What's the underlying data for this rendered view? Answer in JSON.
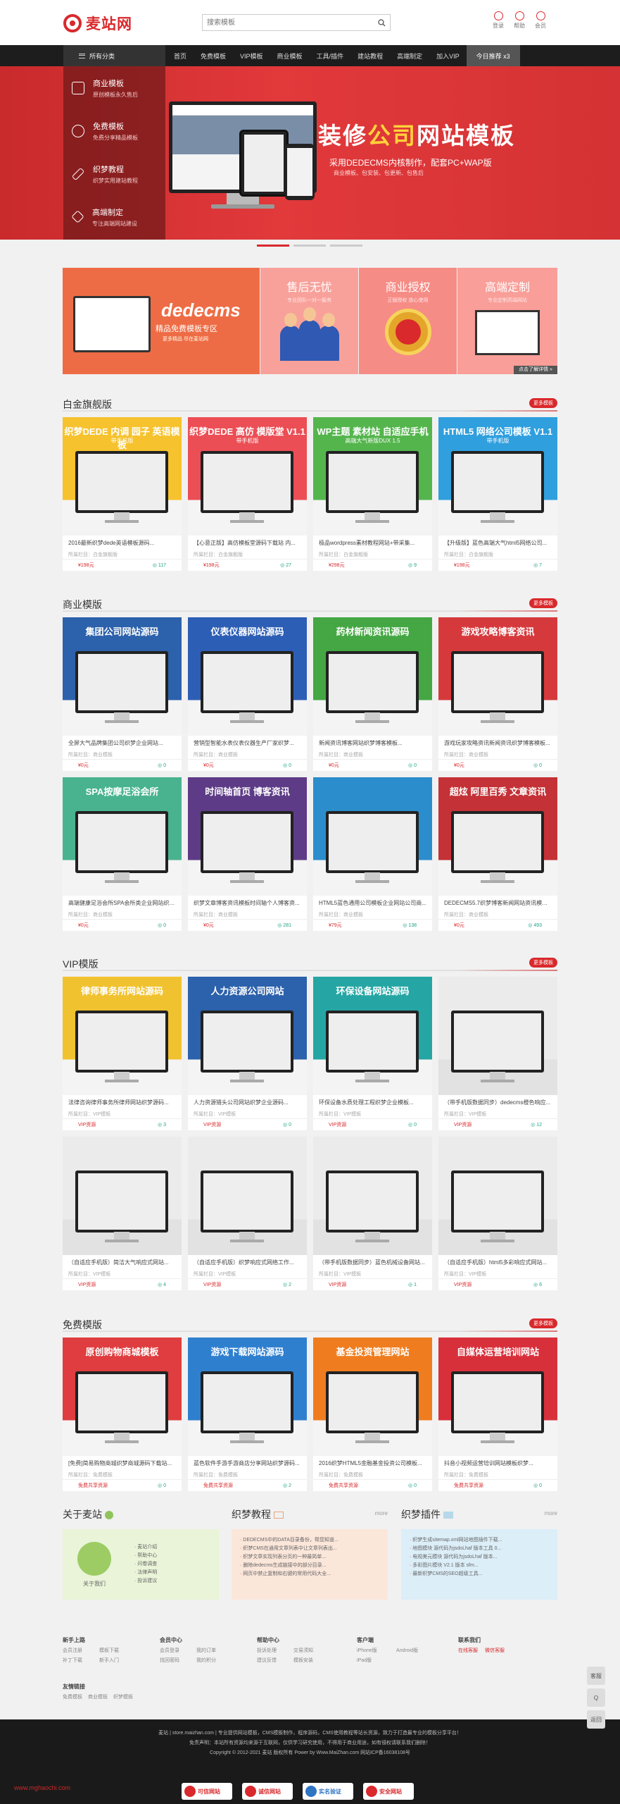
{
  "header": {
    "logo": "麦站网",
    "search_placeholder": "搜索模板",
    "tools": [
      {
        "label": "登录",
        "icon": "user-icon"
      },
      {
        "label": "帮助",
        "icon": "help-icon"
      },
      {
        "label": "会员",
        "icon": "vip-icon"
      }
    ]
  },
  "nav": {
    "all_label": "所有分类",
    "items": [
      "首页",
      "免费模板",
      "VIP模板",
      "商业模板",
      "工具/插件",
      "建站教程",
      "高端制定",
      "加入VIP"
    ],
    "highlight": "今日推荐 x3"
  },
  "categories": [
    {
      "title": "商业模板",
      "sub": "原创模板永久售后",
      "icon": "bag-icon"
    },
    {
      "title": "免费模板",
      "sub": "免费分享精品模板",
      "icon": "heart-icon"
    },
    {
      "title": "织梦教程",
      "sub": "织梦实用建站教程",
      "icon": "pen-icon"
    },
    {
      "title": "高端制定",
      "sub": "专注高端网站建设",
      "icon": "diamond-icon"
    }
  ],
  "banner": {
    "title_a": "装修",
    "title_b": "公司",
    "title_c": "网站模板",
    "sub": "采用DEDECMS内核制作，配套PC+WAP版",
    "sub2": "商业模板、包安装、包更新、包售后"
  },
  "promo": {
    "left_title": "dedecms",
    "left_sub": "精品免费模板专区",
    "left_sub2": "更多精品 尽在麦站网",
    "cols": [
      {
        "title": "售后无忧",
        "sub": "专业团队一对一服务"
      },
      {
        "title": "商业授权",
        "sub": "正版授权 放心使用"
      },
      {
        "title": "高端定制",
        "sub": "专业定制高端网站"
      }
    ],
    "more": "点击了解详情 »"
  },
  "sections": [
    {
      "title": "白金旗舰版",
      "more": "更多模板",
      "cards": [
        {
          "t1": "织梦DEDE 内调 园子 英语模板",
          "t2": "带手机版",
          "bg": "#f6c22d",
          "name": "2016最新织梦dede英语模板源码...",
          "meta": "所属栏目：白金旗舰版",
          "price": "¥198元",
          "dl": "117"
        },
        {
          "t1": "织梦DEDE 高仿 模版堂 V1.1",
          "t2": "带手机版",
          "bg": "#ec4e55",
          "name": "【心意正版】高仿模板堂源码下载站 内...",
          "meta": "所属栏目：白金旗舰版",
          "price": "¥198元",
          "dl": "27"
        },
        {
          "t1": "WP主题 素材站 自适应手机",
          "t2": "高端大气新版DUX 1.5",
          "bg": "#54b54d",
          "name": "极品wordpress素材教程网站+带采集...",
          "meta": "所属栏目：白金旗舰版",
          "price": "¥298元",
          "dl": "9"
        },
        {
          "t1": "HTML5 网络公司模板 V1.1",
          "t2": "带手机版",
          "bg": "#2f9fde",
          "name": "【升级版】蓝色高端大气html5网络公司...",
          "meta": "所属栏目：白金旗舰版",
          "price": "¥198元",
          "dl": "7"
        }
      ]
    },
    {
      "title": "商业模版",
      "more": "更多模板",
      "cards": [
        {
          "t1": "集团公司网站源码",
          "t2": "",
          "bg": "#2c61ab",
          "name": "全屏大气品牌集团公司织梦企业网站...",
          "meta": "所属栏目：商业模板",
          "price": "¥0元",
          "dl": "0"
        },
        {
          "t1": "仪表仪器网站源码",
          "t2": "",
          "bg": "#2d5eb5",
          "name": "营销型智能水表仪表仪器生产厂家织梦...",
          "meta": "所属栏目：商业模板",
          "price": "¥0元",
          "dl": "0"
        },
        {
          "t1": "药材新闻资讯源码",
          "t2": "",
          "bg": "#44a743",
          "name": "新闻资讯博客网站织梦博客模板...",
          "meta": "所属栏目：商业模板",
          "price": "¥0元",
          "dl": "0"
        },
        {
          "t1": "游戏攻略博客资讯",
          "t2": "",
          "bg": "#d6393c",
          "name": "游戏玩家攻略资讯新闻资讯织梦博客模板...",
          "meta": "所属栏目：商业模板",
          "price": "¥0元",
          "dl": "0"
        },
        {
          "t1": "SPA按摩足浴会所",
          "t2": "",
          "bg": "#49b390",
          "name": "高端健康足浴会所SPA会所类企业网站织梦...",
          "meta": "所属栏目：商业模板",
          "price": "¥0元",
          "dl": "0"
        },
        {
          "t1": "时间轴首页 博客资讯",
          "t2": "",
          "bg": "#5d3b86",
          "name": "织梦文章博客资讯模板时间轴个人博客资...",
          "meta": "所属栏目：商业模板",
          "price": "¥0元",
          "dl": "281"
        },
        {
          "t1": "",
          "t2": "",
          "bg": "#2b8dcb",
          "name": "HTML5蓝色通用公司模板企业网站公司商...",
          "meta": "所属栏目：商业模板",
          "price": "¥79元",
          "dl": "138"
        },
        {
          "t1": "超炫 阿里百秀 文章资讯",
          "t2": "",
          "bg": "#c43136",
          "name": "DEDECMS5.7织梦博客新闻网站资讯模板...",
          "meta": "所属栏目：商业模板",
          "price": "¥0元",
          "dl": "493"
        }
      ]
    },
    {
      "title": "VIP模版",
      "more": "更多模板",
      "cards": [
        {
          "t1": "律师事务所网站源码",
          "t2": "",
          "bg": "#f1c22f",
          "name": "法律咨询律师事务所律师网站织梦源码...",
          "meta": "所属栏目：VIP模板",
          "price": "VIP资源",
          "dl": "3"
        },
        {
          "t1": "人力资源公司网站",
          "t2": "",
          "bg": "#2c61ab",
          "name": "人力资源猎头公司网站织梦企业源码...",
          "meta": "所属栏目：VIP模板",
          "price": "VIP资源",
          "dl": "0"
        },
        {
          "t1": "环保设备网站源码",
          "t2": "",
          "bg": "#25a6a4",
          "name": "环保设备水质处理工程织梦企业模板...",
          "meta": "所属栏目：VIP模板",
          "price": "VIP资源",
          "dl": "0"
        },
        {
          "t1": "",
          "t2": "",
          "bg": "#ebebeb",
          "name": "（带手机版数据同步）dedecms橙色响应...",
          "meta": "所属栏目：VIP模板",
          "price": "VIP资源",
          "dl": "12"
        },
        {
          "t1": "",
          "t2": "",
          "bg": "#ebebeb",
          "name": "（自适应手机版）简洁大气响应式网站...",
          "meta": "所属栏目：VIP模板",
          "price": "VIP资源",
          "dl": "4"
        },
        {
          "t1": "",
          "t2": "",
          "bg": "#ebebeb",
          "name": "（自适应手机版）织梦响应式网络工作...",
          "meta": "所属栏目：VIP模板",
          "price": "VIP资源",
          "dl": "2"
        },
        {
          "t1": "",
          "t2": "",
          "bg": "#ebebeb",
          "name": "（带手机版数据同步）蓝色机械设备网站...",
          "meta": "所属栏目：VIP模板",
          "price": "VIP资源",
          "dl": "1"
        },
        {
          "t1": "",
          "t2": "",
          "bg": "#ebebeb",
          "name": "（自适应手机版）html5多彩响应式网站...",
          "meta": "所属栏目：VIP模板",
          "price": "VIP资源",
          "dl": "6"
        }
      ]
    },
    {
      "title": "免费模版",
      "more": "更多模板",
      "cards": [
        {
          "t1": "原创购物商城模板",
          "t2": "",
          "bg": "#df3d3f",
          "name": "[免费]简易购物商城织梦商城源码下载站...",
          "meta": "所属栏目：免费模板",
          "price": "免费共享资源",
          "dl": "0"
        },
        {
          "t1": "游戏下载网站源码",
          "t2": "",
          "bg": "#2f7fcf",
          "name": "蓝色软件手游手游商店分享网站织梦源码...",
          "meta": "所属栏目：免费模板",
          "price": "免费共享资源",
          "dl": "2"
        },
        {
          "t1": "基金投资管理网站",
          "t2": "",
          "bg": "#ef7d1f",
          "name": "2016织梦HTML5金融基金投资公司模板...",
          "meta": "所属栏目：免费模板",
          "price": "免费共享资源",
          "dl": "0"
        },
        {
          "t1": "自媒体运营培训网站",
          "t2": "",
          "bg": "#d8303b",
          "name": "抖音小视频运营培训网站模板织梦...",
          "meta": "所属栏目：免费模板",
          "price": "免费共享资源",
          "dl": "0"
        }
      ]
    }
  ],
  "about": {
    "title": "关于麦站",
    "items": [
      "麦站介绍",
      "帮助中心",
      "问卷调查",
      "法律声明",
      "投诉建议"
    ],
    "contact": "关于我们"
  },
  "tutorial": {
    "title": "织梦教程",
    "more": "more",
    "items": [
      "DEDECMS中的DATA目录备份，帮您知道...",
      "织梦CMS在通用文章列表中让文章列表出...",
      "织梦文章实现列表分页的一种最简单...",
      "删除dedecms生成链接中的部分目录...",
      "网页中禁止复制和右键的常用代码大全..."
    ]
  },
  "plugins": {
    "title": "织梦插件",
    "more": "more",
    "items": [
      "织梦生成sitemap.xml网站地图插件下载...",
      "地图模块 源代码为jsdoLhaf 版本工具 0...",
      "电视美元模块 源代码为jsdoLhaf 版本...",
      "多彩图片模块 V2.1 版本 sfm...",
      "最新织梦CMS的SEO超级工具..."
    ]
  },
  "footer_cols": [
    {
      "h": "新手上路",
      "i": [
        "会员注册",
        "补丁下载",
        "模板下载",
        "新手入门"
      ]
    },
    {
      "h": "会员中心",
      "i": [
        "会员登录",
        "找回密码",
        "我的订单",
        "我的积分"
      ]
    },
    {
      "h": "帮助中心",
      "i": [
        "投诉处理",
        "建议反馈",
        "交易须知",
        "模板安装"
      ]
    },
    {
      "h": "客户端",
      "i": [
        "iPhone版",
        "Android版",
        "iPad版"
      ]
    },
    {
      "h": "联系我们",
      "i": [
        "在线客服",
        "微信客服"
      ]
    }
  ],
  "friend": {
    "h": "友情链接",
    "i": [
      "免费模板",
      "商业模板",
      "织梦模板"
    ]
  },
  "footer": {
    "l1": "麦站 | store.maizhan.com | 专业提供网站模板，CMS模板制作，程序源码，CMS使用教程等站长资源，致力于打造最专业的模板分享平台！",
    "l2": "免责声明：本站所有资源均来源于互联网，仅供学习研究使用，不得用于商业用途，如有侵权请联系我们删除！",
    "l3": "Copyright © 2012-2021 麦站 版权所有 Power by Www.MaiZhan.com 网站ICP备16038108号",
    "badges": [
      "可信网站",
      "诚信网站",
      "实名验证",
      "安全网站"
    ]
  },
  "watermark": "www.mghaochi.com",
  "side": [
    "客服",
    "Q",
    "返回"
  ]
}
